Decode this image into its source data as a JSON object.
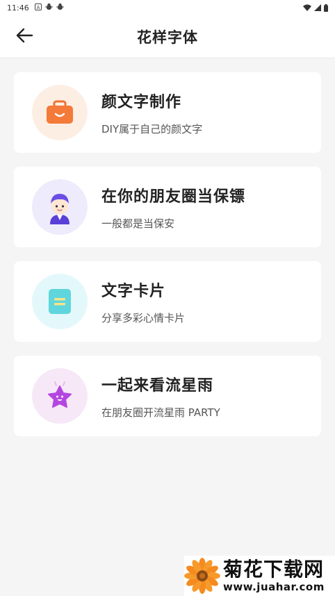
{
  "status_bar": {
    "time": "11:46",
    "icons": [
      "a-notification-icon",
      "bug-icon",
      "bug-icon"
    ],
    "wifi": "wifi-icon",
    "signal": "signal-icon",
    "battery": "battery-icon"
  },
  "app_bar": {
    "back_icon": "arrow-left-icon",
    "title": "花样字体"
  },
  "items": [
    {
      "title": "颜文字制作",
      "subtitle": "DIY属于自己的颜文字",
      "icon": "briefcase-icon",
      "icon_bg": "#fdeee4",
      "icon_color": "#f47a3a"
    },
    {
      "title": "在你的朋友圈当保镖",
      "subtitle": "一般都是当保安",
      "icon": "guard-avatar-icon",
      "icon_bg": "#eeebfc",
      "icon_color": "#6b4de6"
    },
    {
      "title": "文字卡片",
      "subtitle": "分享多彩心情卡片",
      "icon": "card-icon",
      "icon_bg": "#e3f8fa",
      "icon_color": "#5fd6dc"
    },
    {
      "title": "一起来看流星雨",
      "subtitle": "在朋友圈开流星雨 PARTY",
      "icon": "star-icon",
      "icon_bg": "#f7e8f8",
      "icon_color": "#b347e0"
    }
  ],
  "watermark": {
    "name": "菊花下载网",
    "url": "www.juahar.com"
  }
}
